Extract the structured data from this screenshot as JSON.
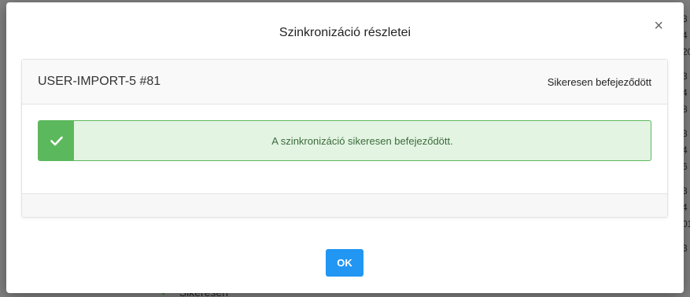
{
  "background": {
    "right_column_fragments": [
      "3",
      "4",
      "20",
      "3",
      "4",
      "8",
      "3",
      "4",
      "6",
      "3",
      "4",
      "01",
      "3"
    ],
    "bottom_row_text": "Sikeresen"
  },
  "modal": {
    "title": "Szinkronizáció részletei",
    "close_label": "×",
    "job": {
      "name": "USER-IMPORT-5 #81",
      "status": "Sikeresen befejeződött"
    },
    "alert": {
      "message": "A szinkronizáció sikeresen befejeződött.",
      "icon": "checkmark-icon"
    },
    "ok_label": "OK"
  },
  "colors": {
    "success": "#5cb85c",
    "success_bg": "#e3f4e3",
    "primary": "#2196f3"
  }
}
